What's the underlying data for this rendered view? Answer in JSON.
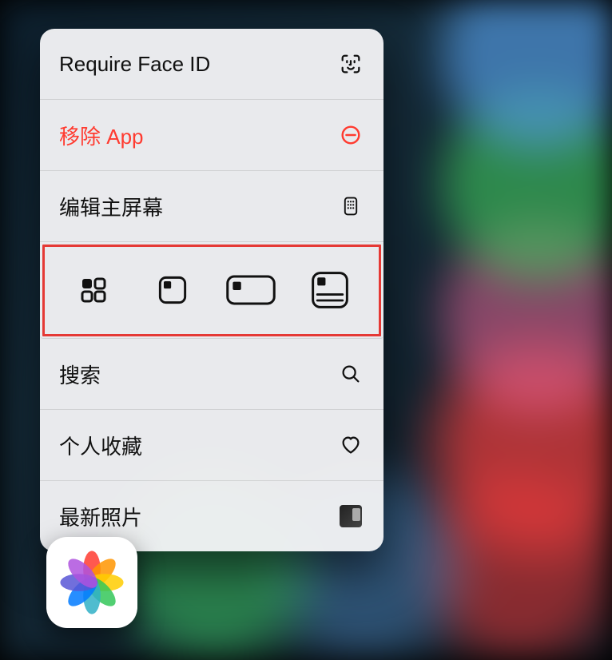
{
  "menu": {
    "face_id": "Require Face ID",
    "remove_app": "移除 App",
    "edit_home": "编辑主屏幕",
    "search": "搜索",
    "favorites": "个人收藏",
    "latest_photos": "最新照片"
  },
  "app_icon_name": "photos-app",
  "highlight": "widget-size-row"
}
